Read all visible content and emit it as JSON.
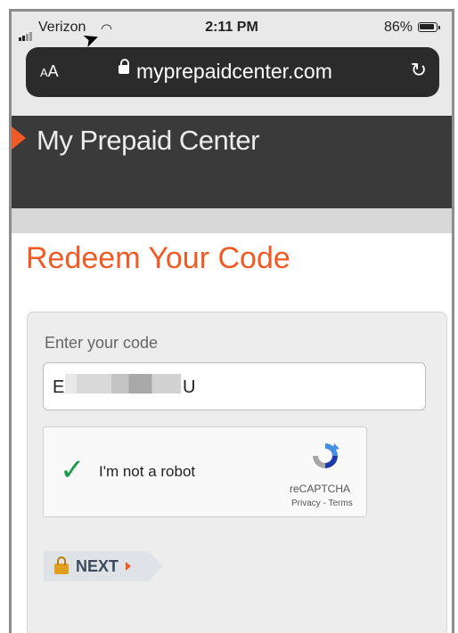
{
  "status_bar": {
    "carrier": "Verizon",
    "time": "2:11 PM",
    "battery": "86%"
  },
  "browser": {
    "text_size_label": "AA",
    "domain": "myprepaidcenter.com",
    "reload_icon": "reload-icon"
  },
  "site": {
    "brand": "My Prepaid Center"
  },
  "page": {
    "heading": "Redeem Your Code",
    "code_label": "Enter your code",
    "code_value_prefix": "E",
    "code_value_suffix": "U",
    "captcha": {
      "label": "I'm not a robot",
      "brand": "reCAPTCHA",
      "links": "Privacy - Terms"
    },
    "next_label": "NEXT"
  },
  "colors": {
    "accent": "#f15a24",
    "header_bg": "#3a3a3a",
    "check": "#1a9e4b"
  }
}
